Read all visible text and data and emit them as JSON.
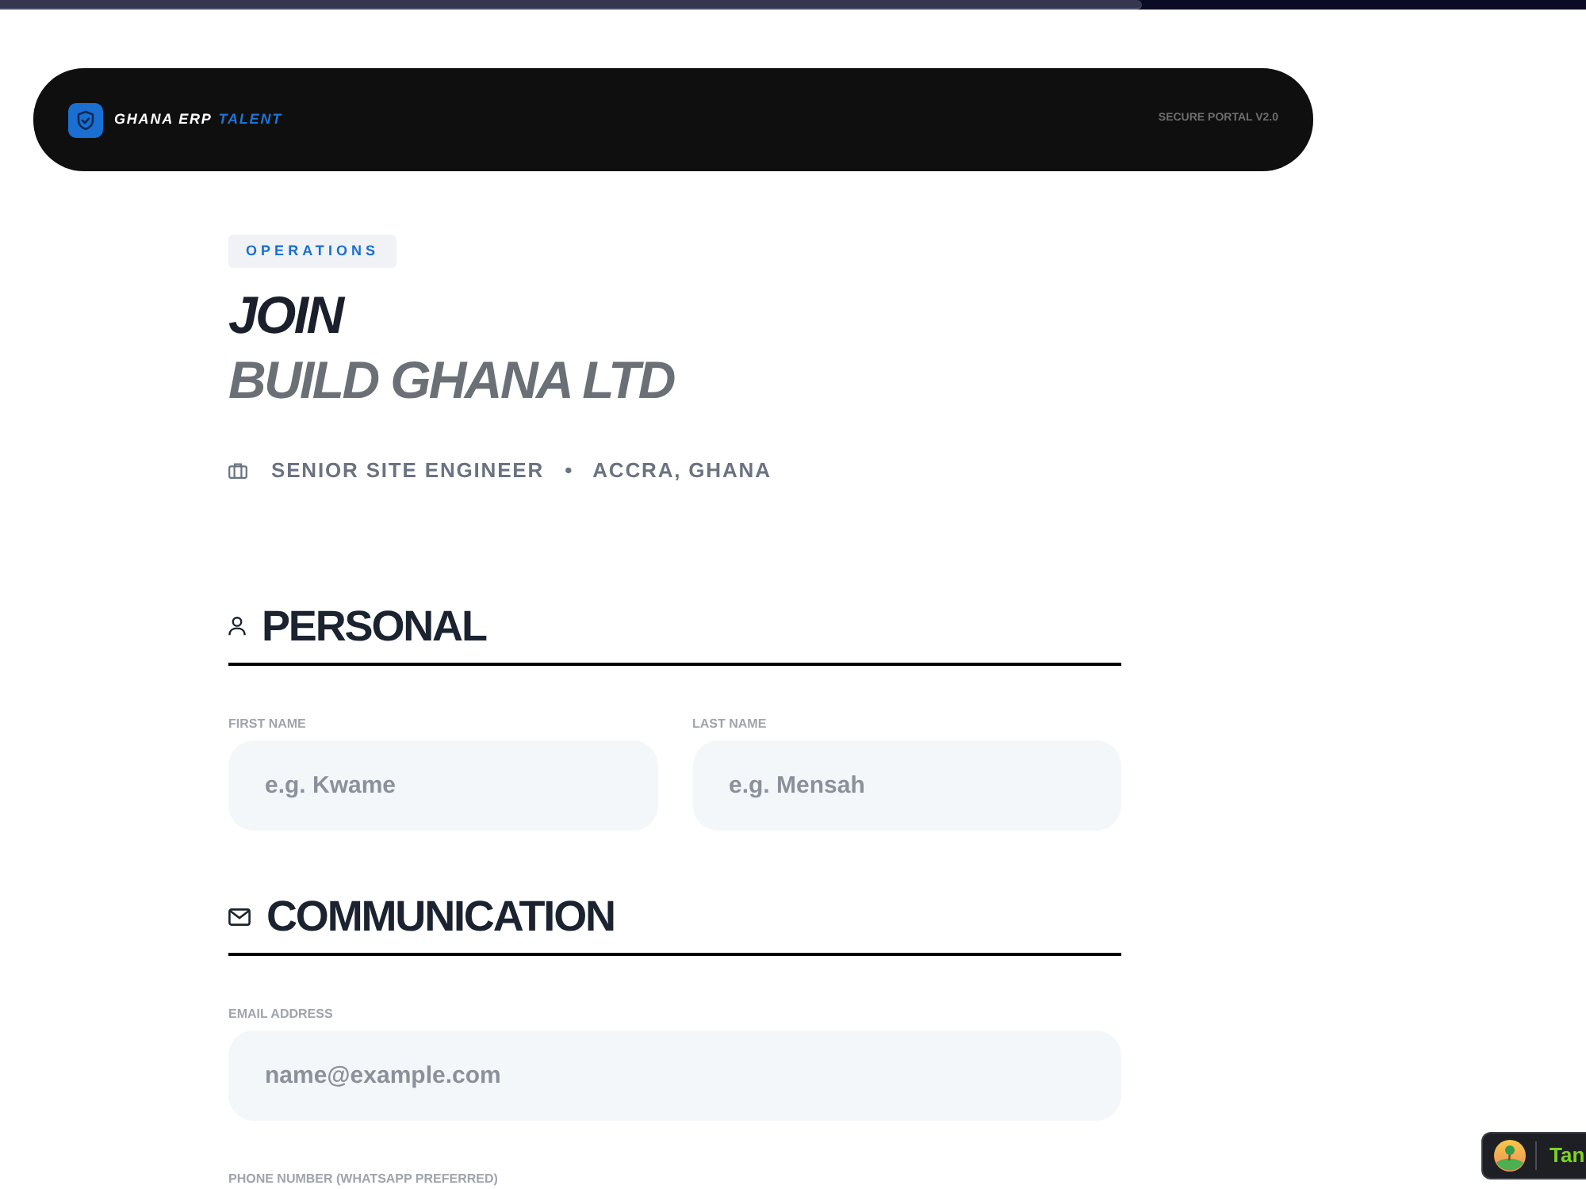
{
  "progress": {
    "level": 0.72
  },
  "header": {
    "brand": "GHANA ERP",
    "brand_accent": "TALENT",
    "portal_label": "SECURE PORTAL V2.0"
  },
  "hero": {
    "department": "OPERATIONS",
    "title": "JOIN",
    "company": "BUILD GHANA LTD",
    "role": "SENIOR SITE ENGINEER",
    "separator": "•",
    "location": "ACCRA, GHANA"
  },
  "sections": [
    {
      "kind": "personal",
      "title": "PERSONAL",
      "rows": [
        [
          {
            "label": "FIRST NAME",
            "placeholder": "e.g. Kwame"
          },
          {
            "label": "LAST NAME",
            "placeholder": "e.g. Mensah"
          }
        ]
      ]
    },
    {
      "kind": "communication",
      "title": "COMMUNICATION",
      "rows": [
        [
          {
            "label": "EMAIL ADDRESS",
            "placeholder": "name@example.com"
          }
        ],
        [
          {
            "label": "PHONE NUMBER (WHATSAPP PREFERRED)"
          }
        ]
      ]
    }
  ],
  "widget": {
    "label": "Tan"
  }
}
